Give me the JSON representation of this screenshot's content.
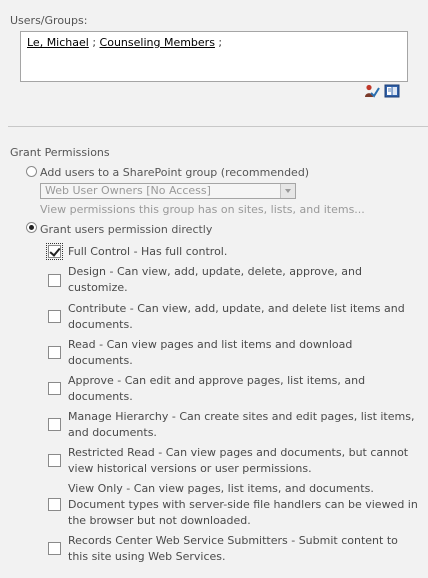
{
  "users_groups": {
    "label": "Users/Groups:",
    "entries": [
      {
        "name": "Le, Michael",
        "sep": " ; "
      },
      {
        "name": "Counseling Members",
        "sep": " ;"
      }
    ],
    "icons": [
      "check-names-icon",
      "browse-directory-icon"
    ]
  },
  "grant": {
    "label": "Grant Permissions",
    "option_group": {
      "label": "Add users to a SharePoint group (recommended)",
      "selected": false
    },
    "group_select": {
      "value": "Web User Owners [No Access]"
    },
    "help_text": "View permissions this group has on sites, lists, and items...",
    "option_direct": {
      "label": "Grant users permission directly",
      "selected": true
    }
  },
  "permissions": [
    {
      "text": "Full Control - Has full control.",
      "checked": true
    },
    {
      "text": "Design - Can view, add, update, delete, approve, and customize.",
      "checked": false
    },
    {
      "text": "Contribute - Can view, add, update, and delete list items and documents.",
      "checked": false
    },
    {
      "text": "Read - Can view pages and list items and download documents.",
      "checked": false
    },
    {
      "text": "Approve - Can edit and approve pages, list items, and documents.",
      "checked": false
    },
    {
      "text": "Manage Hierarchy - Can create sites and edit pages, list items, and documents.",
      "checked": false
    },
    {
      "text": "Restricted Read - Can view pages and documents, but cannot view historical versions or user permissions.",
      "checked": false
    },
    {
      "text": "View Only - Can view pages, list items, and documents. Document types with server-side file handlers can be viewed in the browser but not downloaded.",
      "checked": false
    },
    {
      "text": "Records Center Web Service Submitters - Submit content to this site using Web Services.",
      "checked": false
    }
  ]
}
